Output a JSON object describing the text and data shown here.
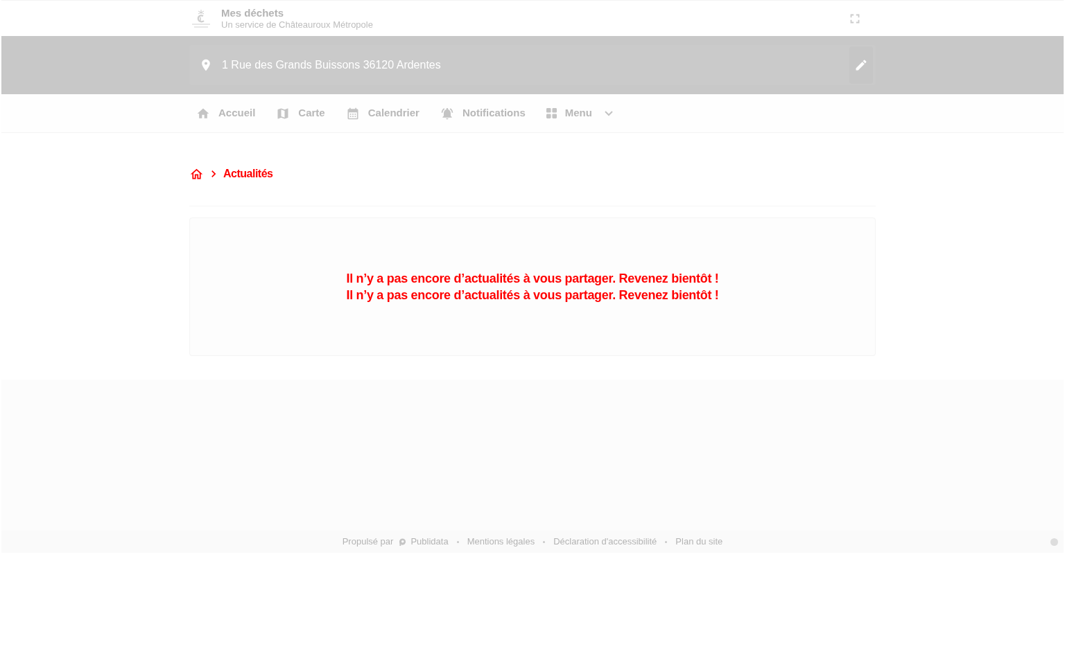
{
  "header": {
    "title": "Mes déchets",
    "subtitle": "Un service de Châteauroux Métropole"
  },
  "address": {
    "value": "1 Rue des Grands Buissons 36120 Ardentes"
  },
  "nav": {
    "items": [
      {
        "label": "Accueil",
        "kind": "link"
      },
      {
        "label": "Carte",
        "kind": "link"
      },
      {
        "label": "Calendrier",
        "kind": "link"
      },
      {
        "label": "Notifications",
        "kind": "link"
      },
      {
        "label": "Menu",
        "kind": "dropdown"
      }
    ]
  },
  "breadcrumb": {
    "current": "Actualités"
  },
  "news": {
    "empty_message_lines": [
      "Il n’y a pas encore d’actualités à vous partager. Revenez bientôt !",
      "Il n’y a pas encore d’actualités à vous partager. Revenez bientôt !"
    ]
  },
  "footer": {
    "powered_by": "Propulsé par",
    "brand": "Publidata",
    "links": [
      "Mentions légales",
      "Déclaration d'accessibilité",
      "Plan du site"
    ]
  }
}
